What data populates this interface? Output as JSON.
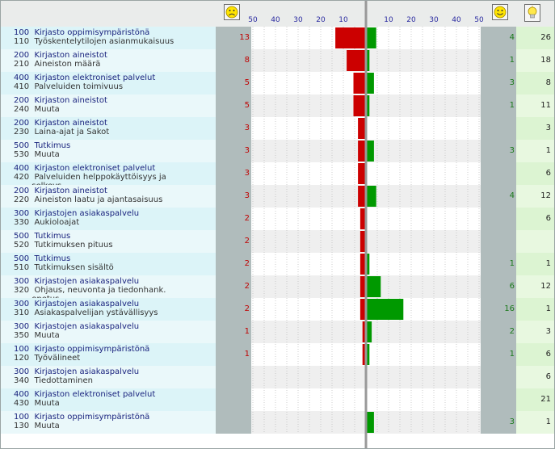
{
  "header": {
    "left_icon": "sad-face-icon",
    "right_icon": "happy-face-icon",
    "total_icon": "lightbulb-icon",
    "left_ticks": [
      "50",
      "40",
      "30",
      "20",
      "10"
    ],
    "right_ticks": [
      "10",
      "20",
      "30",
      "40",
      "50"
    ]
  },
  "colors": {
    "negative_bar": "#cc0000",
    "positive_bar": "#009900",
    "center_line": "#999999"
  },
  "chart_data": {
    "type": "bar",
    "orientation": "horizontal-diverging",
    "xlim": [
      -50,
      50
    ],
    "grid": true,
    "rows": [
      {
        "lines": [
          "100  Kirjasto oppimisympäristönä",
          "110  Työskentelytilojen asianmukaisuus"
        ],
        "negative": "13",
        "positive": "4",
        "total": "26",
        "neg": 13,
        "pos": 4
      },
      {
        "lines": [
          "200  Kirjaston aineistot",
          "210  Aineiston määrä"
        ],
        "negative": "8",
        "positive": "1",
        "total": "18",
        "neg": 8,
        "pos": 1
      },
      {
        "lines": [
          "400  Kirjaston elektroniset palvelut",
          "410  Palveluiden toimivuus"
        ],
        "negative": "5",
        "positive": "3",
        "total": "8",
        "neg": 5,
        "pos": 3
      },
      {
        "lines": [
          "200  Kirjaston aineistot",
          "240  Muuta"
        ],
        "negative": "5",
        "positive": "1",
        "total": "11",
        "neg": 5,
        "pos": 1
      },
      {
        "lines": [
          "200  Kirjaston aineistot",
          "230  Laina-ajat ja Sakot"
        ],
        "negative": "3",
        "positive": "",
        "total": "3",
        "neg": 3,
        "pos": 0
      },
      {
        "lines": [
          "500  Tutkimus",
          "530  Muuta"
        ],
        "negative": "3",
        "positive": "3",
        "total": "1",
        "neg": 3,
        "pos": 3
      },
      {
        "lines": [
          "400  Kirjaston elektroniset palvelut",
          "420  Palveluiden helppokäyttöisyys ja",
          "       selkeys"
        ],
        "negative": "3",
        "positive": "",
        "total": "6",
        "neg": 3,
        "pos": 0
      },
      {
        "lines": [
          "200  Kirjaston aineistot",
          "220  Aineiston laatu ja ajantasaisuus"
        ],
        "negative": "3",
        "positive": "4",
        "total": "12",
        "neg": 3,
        "pos": 4
      },
      {
        "lines": [
          "300  Kirjastojen asiakaspalvelu",
          "330  Aukioloajat"
        ],
        "negative": "2",
        "positive": "",
        "total": "6",
        "neg": 2,
        "pos": 0
      },
      {
        "lines": [
          "500  Tutkimus",
          "520  Tutkimuksen pituus"
        ],
        "negative": "2",
        "positive": "",
        "total": "",
        "neg": 2,
        "pos": 0
      },
      {
        "lines": [
          "500  Tutkimus",
          "510  Tutkimuksen sisältö"
        ],
        "negative": "2",
        "positive": "1",
        "total": "1",
        "neg": 2,
        "pos": 1
      },
      {
        "lines": [
          "300  Kirjastojen asiakaspalvelu",
          "320  Ohjaus, neuvonta ja tiedonhank.",
          "       opetus"
        ],
        "negative": "2",
        "positive": "6",
        "total": "12",
        "neg": 2,
        "pos": 6
      },
      {
        "lines": [
          "300  Kirjastojen asiakaspalvelu",
          "310  Asiakaspalvelijan ystävällisyys"
        ],
        "negative": "2",
        "positive": "16",
        "total": "1",
        "neg": 2,
        "pos": 16
      },
      {
        "lines": [
          "300  Kirjastojen asiakaspalvelu",
          "350  Muuta"
        ],
        "negative": "1",
        "positive": "2",
        "total": "3",
        "neg": 1,
        "pos": 2
      },
      {
        "lines": [
          "100  Kirjasto oppimisympäristönä",
          "120  Työvälineet"
        ],
        "negative": "1",
        "positive": "1",
        "total": "6",
        "neg": 1,
        "pos": 1
      },
      {
        "lines": [
          "300  Kirjastojen asiakaspalvelu",
          "340  Tiedottaminen"
        ],
        "negative": "",
        "positive": "",
        "total": "6",
        "neg": 0,
        "pos": 0
      },
      {
        "lines": [
          "400  Kirjaston elektroniset palvelut",
          "430  Muuta"
        ],
        "negative": "",
        "positive": "",
        "total": "21",
        "neg": 0,
        "pos": 0
      },
      {
        "lines": [
          "100  Kirjasto oppimisympäristönä",
          "130  Muuta"
        ],
        "negative": "",
        "positive": "3",
        "total": "1",
        "neg": 0,
        "pos": 3
      }
    ]
  }
}
